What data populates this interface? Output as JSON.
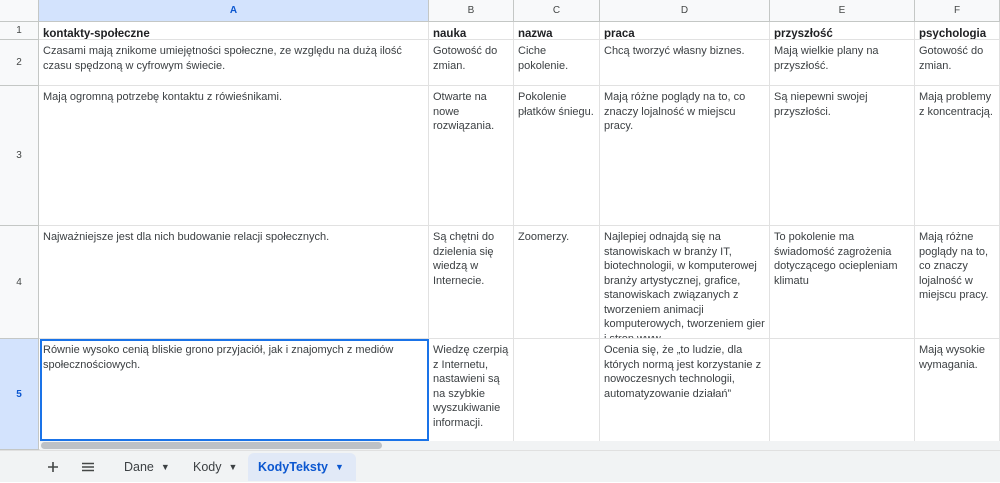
{
  "columns": [
    "A",
    "B",
    "C",
    "D",
    "E",
    "F"
  ],
  "rows": [
    "1",
    "2",
    "3",
    "4",
    "5"
  ],
  "headers": [
    "kontakty-społeczne",
    "nauka",
    "nazwa",
    "praca",
    "przyszłość",
    "psychologia"
  ],
  "data": [
    [
      "Czasami mają znikome umiejętności społeczne, ze względu na dużą ilość czasu spędzoną w cyfrowym świecie.",
      "Gotowość do zmian.",
      "Ciche pokolenie.",
      "Chcą tworzyć własny biznes.",
      "Mają wielkie plany na przyszłość.",
      "Gotowość do zmian."
    ],
    [
      "Mają ogromną potrzebę kontaktu z rówieśnikami.",
      "Otwarte na nowe rozwiązania.",
      "Pokolenie płatków śniegu.",
      "Mają różne poglądy na to, co znaczy lojalność w miejscu pracy.",
      "Są niepewni swojej przyszłości.",
      "Mają problemy z koncentracją."
    ],
    [
      "Najważniejsze jest dla nich budowanie relacji społecznych.",
      "Są chętni do dzielenia się wiedzą w Internecie.",
      "Zoomerzy.",
      "Najlepiej odnajdą się na stanowiskach w branży IT, biotechnologii, w komputerowej branży artystycznej, grafice, stanowiskach związanych z tworzeniem animacji komputerowych, tworzeniem gier i stron www",
      "To pokolenie ma świadomość zagrożenia dotyczącego ociepleniam klimatu",
      "Mają różne poglądy na to, co znaczy lojalność w miejscu pracy."
    ],
    [
      "Równie wysoko cenią bliskie grono przyjaciół, jak i znajomych z mediów społecznościowych.",
      "Wiedzę czerpią z Internetu, nastawieni są na szybkie wyszukiwanie informacji.",
      "",
      "Ocenia się, że „to ludzie, dla których normą jest korzystanie z nowoczesnych technologii, automatyzowanie działań”",
      "",
      "Mają wysokie wymagania."
    ]
  ],
  "tabs": [
    {
      "label": "Dane"
    },
    {
      "label": "Kody"
    },
    {
      "label": "KodyTeksty"
    }
  ],
  "active_tab": "KodyTeksty",
  "active_cell": "A5",
  "icons": {
    "add_sheet": "plus-icon",
    "all_sheets": "menu-icon",
    "tab_menu": "caret-down-icon"
  },
  "colors": {
    "selection_border": "#1a73e8",
    "selected_header_bg": "#d3e3fd",
    "active_tab_bg": "#e1e9f7",
    "active_tab_text": "#0b57d0"
  }
}
